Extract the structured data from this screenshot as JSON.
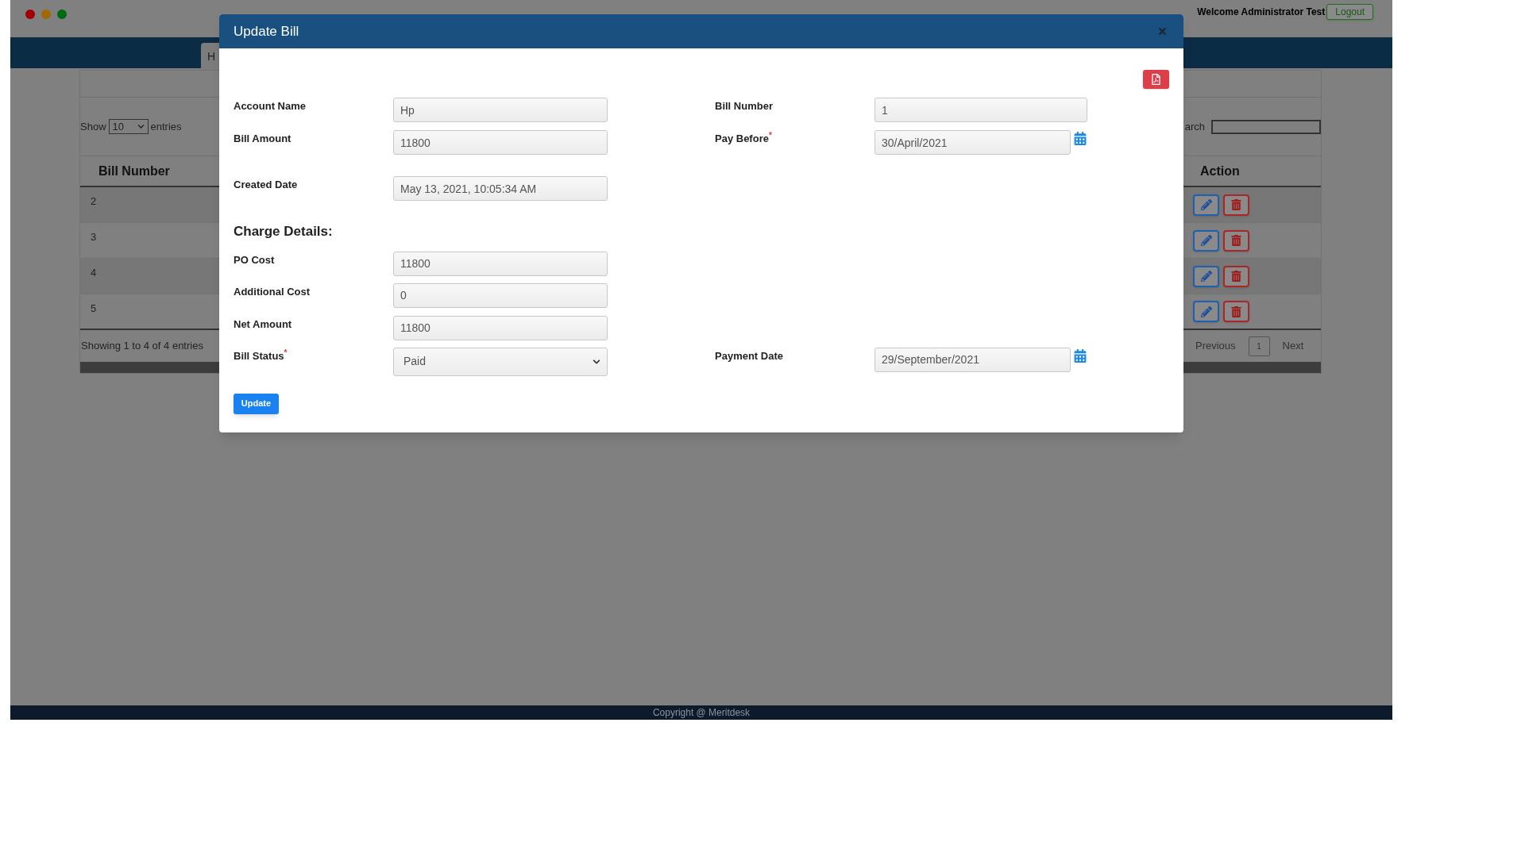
{
  "header": {
    "welcome": "Welcome Administrator Test",
    "logout": "Logout"
  },
  "nav": {
    "tabs": [
      {
        "label": "H"
      }
    ]
  },
  "bills_table": {
    "show_label": "Show",
    "page_size": "10",
    "entries_label": "entries",
    "search_label": "arch",
    "columns": [
      "Bill Number",
      "Action"
    ],
    "rows": [
      {
        "bill_number": "2"
      },
      {
        "bill_number": "3"
      },
      {
        "bill_number": "4"
      },
      {
        "bill_number": "5"
      }
    ],
    "info": "Showing 1 to 4 of 4 entries",
    "pagination": {
      "previous": "Previous",
      "page": "1",
      "next": "Next"
    }
  },
  "footer": "Copyright @ Meritdesk",
  "modal": {
    "title": "Update Bill",
    "top_rows": [
      {
        "left": {
          "label": "Account Name",
          "value": "Hp",
          "required": false,
          "kind": "text"
        },
        "right": {
          "label": "Bill Number",
          "value": "1",
          "required": false,
          "kind": "text"
        }
      },
      {
        "left": {
          "label": "Bill Amount",
          "value": "11800",
          "required": false,
          "kind": "text"
        },
        "right": {
          "label": "Pay Before",
          "value": "30/April/2021",
          "required": true,
          "kind": "date"
        }
      },
      {
        "left": {
          "label": "Created Date",
          "value": "May 13, 2021, 10:05:34 AM",
          "required": false,
          "kind": "text"
        }
      }
    ],
    "section_title": "Charge Details:",
    "charge_rows": [
      {
        "left": {
          "label": "PO Cost",
          "value": "11800",
          "required": false,
          "kind": "text"
        }
      },
      {
        "left": {
          "label": "Additional Cost",
          "value": "0",
          "required": false,
          "kind": "text"
        }
      },
      {
        "left": {
          "label": "Net Amount",
          "value": "11800",
          "required": false,
          "kind": "text"
        }
      },
      {
        "left": {
          "label": "Bill Status",
          "value": "Paid",
          "required": true,
          "kind": "select"
        },
        "right": {
          "label": "Payment Date",
          "value": "29/September/2021",
          "required": false,
          "kind": "date"
        }
      }
    ],
    "submit": "Update",
    "required_marker": "*"
  }
}
